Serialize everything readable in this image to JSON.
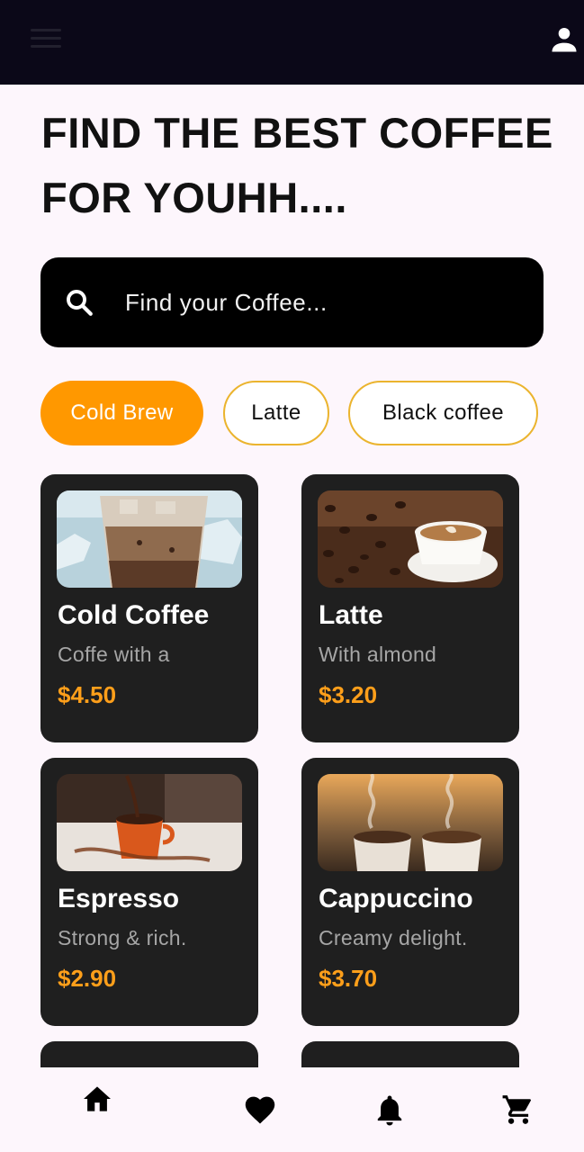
{
  "header": {
    "title": "FIND THE BEST COFFEE FOR YOUHH...."
  },
  "search": {
    "placeholder": "Find your Coffee..."
  },
  "categories": [
    {
      "label": "Cold Brew",
      "active": true
    },
    {
      "label": "Latte",
      "active": false
    },
    {
      "label": "Black coffee",
      "active": false
    }
  ],
  "products": [
    {
      "name": "Cold Coffee",
      "description": "Coffe with a",
      "price": "$4.50"
    },
    {
      "name": "Latte",
      "description": "With almond",
      "price": "$3.20"
    },
    {
      "name": "Espresso",
      "description": "Strong & rich.",
      "price": "$2.90"
    },
    {
      "name": "Cappuccino",
      "description": "Creamy delight.",
      "price": "$3.70"
    }
  ],
  "nav": {
    "items": [
      "home-icon",
      "heart-icon",
      "bell-icon",
      "cart-icon"
    ],
    "selected": "home-icon"
  },
  "colors": {
    "accent": "#ff9800",
    "price": "#ff9f1a",
    "card": "#1f1f1f",
    "topbar": "#0b0818",
    "background": "#fdf6fc"
  }
}
